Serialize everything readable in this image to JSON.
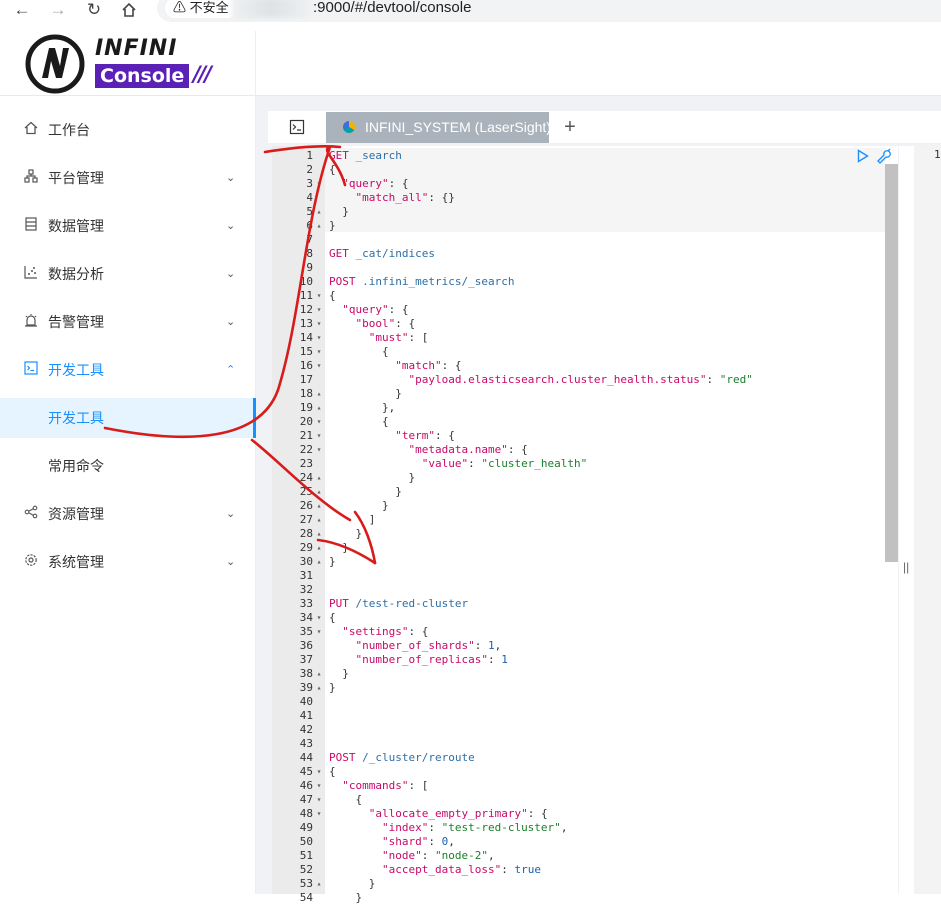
{
  "browser": {
    "security_label": "不安全",
    "url_suffix": ":9000/#/devtool/console",
    "icons": [
      "back-arrow-icon",
      "forward-arrow-icon",
      "reload-icon",
      "home-icon",
      "warning-icon"
    ]
  },
  "logo": {
    "word1": "INFINI",
    "word2": "Console",
    "slashes": "///"
  },
  "sidebar": {
    "items": [
      {
        "label": "工作台",
        "icon": "home-icon",
        "has_arrow": false
      },
      {
        "label": "平台管理",
        "icon": "cluster-icon",
        "has_arrow": true
      },
      {
        "label": "数据管理",
        "icon": "database-icon",
        "has_arrow": true
      },
      {
        "label": "数据分析",
        "icon": "chart-icon",
        "has_arrow": true
      },
      {
        "label": "告警管理",
        "icon": "alarm-icon",
        "has_arrow": true
      },
      {
        "label": "开发工具",
        "icon": "console-icon",
        "has_arrow": true,
        "expanded": true
      },
      {
        "label": "资源管理",
        "icon": "share-icon",
        "has_arrow": true
      },
      {
        "label": "系统管理",
        "icon": "settings-icon",
        "has_arrow": true
      }
    ],
    "sub_items": [
      {
        "label": "开发工具",
        "selected": true
      },
      {
        "label": "常用命令",
        "selected": false
      }
    ]
  },
  "tabs": {
    "console_icon": "console-icon",
    "cluster_tab_label": "INFINI_SYSTEM (LaserSight)",
    "add_label": "+"
  },
  "editor": {
    "lines": [
      {
        "n": "1",
        "fold": "",
        "tokens": [
          [
            "method",
            "GET"
          ],
          [
            "plain",
            " "
          ],
          [
            "path",
            "_search"
          ]
        ]
      },
      {
        "n": "2",
        "fold": "",
        "tokens": [
          [
            "plain",
            "{"
          ]
        ]
      },
      {
        "n": "3",
        "fold": "▾",
        "tokens": [
          [
            "plain",
            "  "
          ],
          [
            "key",
            "\"query\""
          ],
          [
            "plain",
            ": {"
          ]
        ]
      },
      {
        "n": "4",
        "fold": "",
        "tokens": [
          [
            "plain",
            "    "
          ],
          [
            "key",
            "\"match_all\""
          ],
          [
            "plain",
            ": {}"
          ]
        ]
      },
      {
        "n": "5",
        "fold": "▴",
        "tokens": [
          [
            "plain",
            "  }"
          ]
        ]
      },
      {
        "n": "6",
        "fold": "▴",
        "tokens": [
          [
            "plain",
            "}"
          ]
        ]
      },
      {
        "n": "7",
        "fold": "",
        "tokens": []
      },
      {
        "n": "8",
        "fold": "",
        "tokens": [
          [
            "method",
            "GET"
          ],
          [
            "plain",
            " "
          ],
          [
            "path",
            "_cat/indices"
          ]
        ]
      },
      {
        "n": "9",
        "fold": "",
        "tokens": []
      },
      {
        "n": "10",
        "fold": "",
        "tokens": [
          [
            "method",
            "POST"
          ],
          [
            "plain",
            " "
          ],
          [
            "path",
            ".infini_metrics/_search"
          ]
        ]
      },
      {
        "n": "11",
        "fold": "▾",
        "tokens": [
          [
            "plain",
            "{"
          ]
        ]
      },
      {
        "n": "12",
        "fold": "▾",
        "tokens": [
          [
            "plain",
            "  "
          ],
          [
            "key",
            "\"query\""
          ],
          [
            "plain",
            ": {"
          ]
        ]
      },
      {
        "n": "13",
        "fold": "▾",
        "tokens": [
          [
            "plain",
            "    "
          ],
          [
            "key",
            "\"bool\""
          ],
          [
            "plain",
            ": {"
          ]
        ]
      },
      {
        "n": "14",
        "fold": "▾",
        "tokens": [
          [
            "plain",
            "      "
          ],
          [
            "key",
            "\"must\""
          ],
          [
            "plain",
            ": ["
          ]
        ]
      },
      {
        "n": "15",
        "fold": "▾",
        "tokens": [
          [
            "plain",
            "        {"
          ]
        ]
      },
      {
        "n": "16",
        "fold": "▾",
        "tokens": [
          [
            "plain",
            "          "
          ],
          [
            "key",
            "\"match\""
          ],
          [
            "plain",
            ": {"
          ]
        ]
      },
      {
        "n": "17",
        "fold": "",
        "tokens": [
          [
            "plain",
            "            "
          ],
          [
            "key",
            "\"payload.elasticsearch.cluster_health.status\""
          ],
          [
            "plain",
            ": "
          ],
          [
            "str",
            "\"red\""
          ]
        ]
      },
      {
        "n": "18",
        "fold": "▴",
        "tokens": [
          [
            "plain",
            "          }"
          ]
        ]
      },
      {
        "n": "19",
        "fold": "▴",
        "tokens": [
          [
            "plain",
            "        },"
          ]
        ]
      },
      {
        "n": "20",
        "fold": "▾",
        "tokens": [
          [
            "plain",
            "        {"
          ]
        ]
      },
      {
        "n": "21",
        "fold": "▾",
        "tokens": [
          [
            "plain",
            "          "
          ],
          [
            "key",
            "\"term\""
          ],
          [
            "plain",
            ": {"
          ]
        ]
      },
      {
        "n": "22",
        "fold": "▾",
        "tokens": [
          [
            "plain",
            "            "
          ],
          [
            "key",
            "\"metadata.name\""
          ],
          [
            "plain",
            ": {"
          ]
        ]
      },
      {
        "n": "23",
        "fold": "",
        "tokens": [
          [
            "plain",
            "              "
          ],
          [
            "key",
            "\"value\""
          ],
          [
            "plain",
            ": "
          ],
          [
            "str",
            "\"cluster_health\""
          ]
        ]
      },
      {
        "n": "24",
        "fold": "▴",
        "tokens": [
          [
            "plain",
            "            }"
          ]
        ]
      },
      {
        "n": "25",
        "fold": "▴",
        "tokens": [
          [
            "plain",
            "          }"
          ]
        ]
      },
      {
        "n": "26",
        "fold": "▴",
        "tokens": [
          [
            "plain",
            "        }"
          ]
        ]
      },
      {
        "n": "27",
        "fold": "▴",
        "tokens": [
          [
            "plain",
            "      ]"
          ]
        ]
      },
      {
        "n": "28",
        "fold": "▴",
        "tokens": [
          [
            "plain",
            "    }"
          ]
        ]
      },
      {
        "n": "29",
        "fold": "▴",
        "tokens": [
          [
            "plain",
            "  }"
          ]
        ]
      },
      {
        "n": "30",
        "fold": "▴",
        "tokens": [
          [
            "plain",
            "}"
          ]
        ]
      },
      {
        "n": "31",
        "fold": "",
        "tokens": []
      },
      {
        "n": "32",
        "fold": "",
        "tokens": []
      },
      {
        "n": "33",
        "fold": "",
        "tokens": [
          [
            "method",
            "PUT"
          ],
          [
            "plain",
            " "
          ],
          [
            "path",
            "/test-red-cluster"
          ]
        ]
      },
      {
        "n": "34",
        "fold": "▾",
        "tokens": [
          [
            "plain",
            "{"
          ]
        ]
      },
      {
        "n": "35",
        "fold": "▾",
        "tokens": [
          [
            "plain",
            "  "
          ],
          [
            "key",
            "\"settings\""
          ],
          [
            "plain",
            ": {"
          ]
        ]
      },
      {
        "n": "36",
        "fold": "",
        "tokens": [
          [
            "plain",
            "    "
          ],
          [
            "key",
            "\"number_of_shards\""
          ],
          [
            "plain",
            ": "
          ],
          [
            "num",
            "1"
          ],
          [
            "plain",
            ","
          ]
        ]
      },
      {
        "n": "37",
        "fold": "",
        "tokens": [
          [
            "plain",
            "    "
          ],
          [
            "key",
            "\"number_of_replicas\""
          ],
          [
            "plain",
            ": "
          ],
          [
            "num",
            "1"
          ]
        ]
      },
      {
        "n": "38",
        "fold": "▴",
        "tokens": [
          [
            "plain",
            "  }"
          ]
        ]
      },
      {
        "n": "39",
        "fold": "▴",
        "tokens": [
          [
            "plain",
            "}"
          ]
        ]
      },
      {
        "n": "40",
        "fold": "",
        "tokens": []
      },
      {
        "n": "41",
        "fold": "",
        "tokens": []
      },
      {
        "n": "42",
        "fold": "",
        "tokens": []
      },
      {
        "n": "43",
        "fold": "",
        "tokens": []
      },
      {
        "n": "44",
        "fold": "",
        "tokens": [
          [
            "method",
            "POST"
          ],
          [
            "plain",
            " "
          ],
          [
            "path",
            "/_cluster/reroute"
          ]
        ]
      },
      {
        "n": "45",
        "fold": "▾",
        "tokens": [
          [
            "plain",
            "{"
          ]
        ]
      },
      {
        "n": "46",
        "fold": "▾",
        "tokens": [
          [
            "plain",
            "  "
          ],
          [
            "key",
            "\"commands\""
          ],
          [
            "plain",
            ": ["
          ]
        ]
      },
      {
        "n": "47",
        "fold": "▾",
        "tokens": [
          [
            "plain",
            "    {"
          ]
        ]
      },
      {
        "n": "48",
        "fold": "▾",
        "tokens": [
          [
            "plain",
            "      "
          ],
          [
            "key",
            "\"allocate_empty_primary\""
          ],
          [
            "plain",
            ": {"
          ]
        ]
      },
      {
        "n": "49",
        "fold": "",
        "tokens": [
          [
            "plain",
            "        "
          ],
          [
            "key",
            "\"index\""
          ],
          [
            "plain",
            ": "
          ],
          [
            "str",
            "\"test-red-cluster\""
          ],
          [
            "plain",
            ","
          ]
        ]
      },
      {
        "n": "50",
        "fold": "",
        "tokens": [
          [
            "plain",
            "        "
          ],
          [
            "key",
            "\"shard\""
          ],
          [
            "plain",
            ": "
          ],
          [
            "num",
            "0"
          ],
          [
            "plain",
            ","
          ]
        ]
      },
      {
        "n": "51",
        "fold": "",
        "tokens": [
          [
            "plain",
            "        "
          ],
          [
            "key",
            "\"node\""
          ],
          [
            "plain",
            ": "
          ],
          [
            "str",
            "\"node-2\""
          ],
          [
            "plain",
            ","
          ]
        ]
      },
      {
        "n": "52",
        "fold": "",
        "tokens": [
          [
            "plain",
            "        "
          ],
          [
            "key",
            "\"accept_data_loss\""
          ],
          [
            "plain",
            ": "
          ],
          [
            "bool",
            "true"
          ]
        ]
      },
      {
        "n": "53",
        "fold": "▴",
        "tokens": [
          [
            "plain",
            "      }"
          ]
        ]
      },
      {
        "n": "54",
        "fold": "",
        "tokens": [
          [
            "plain",
            "    }"
          ]
        ]
      }
    ],
    "run_icon": "play-icon",
    "wrench_icon": "wrench-icon",
    "response_line": "1",
    "split_handle": "||"
  }
}
